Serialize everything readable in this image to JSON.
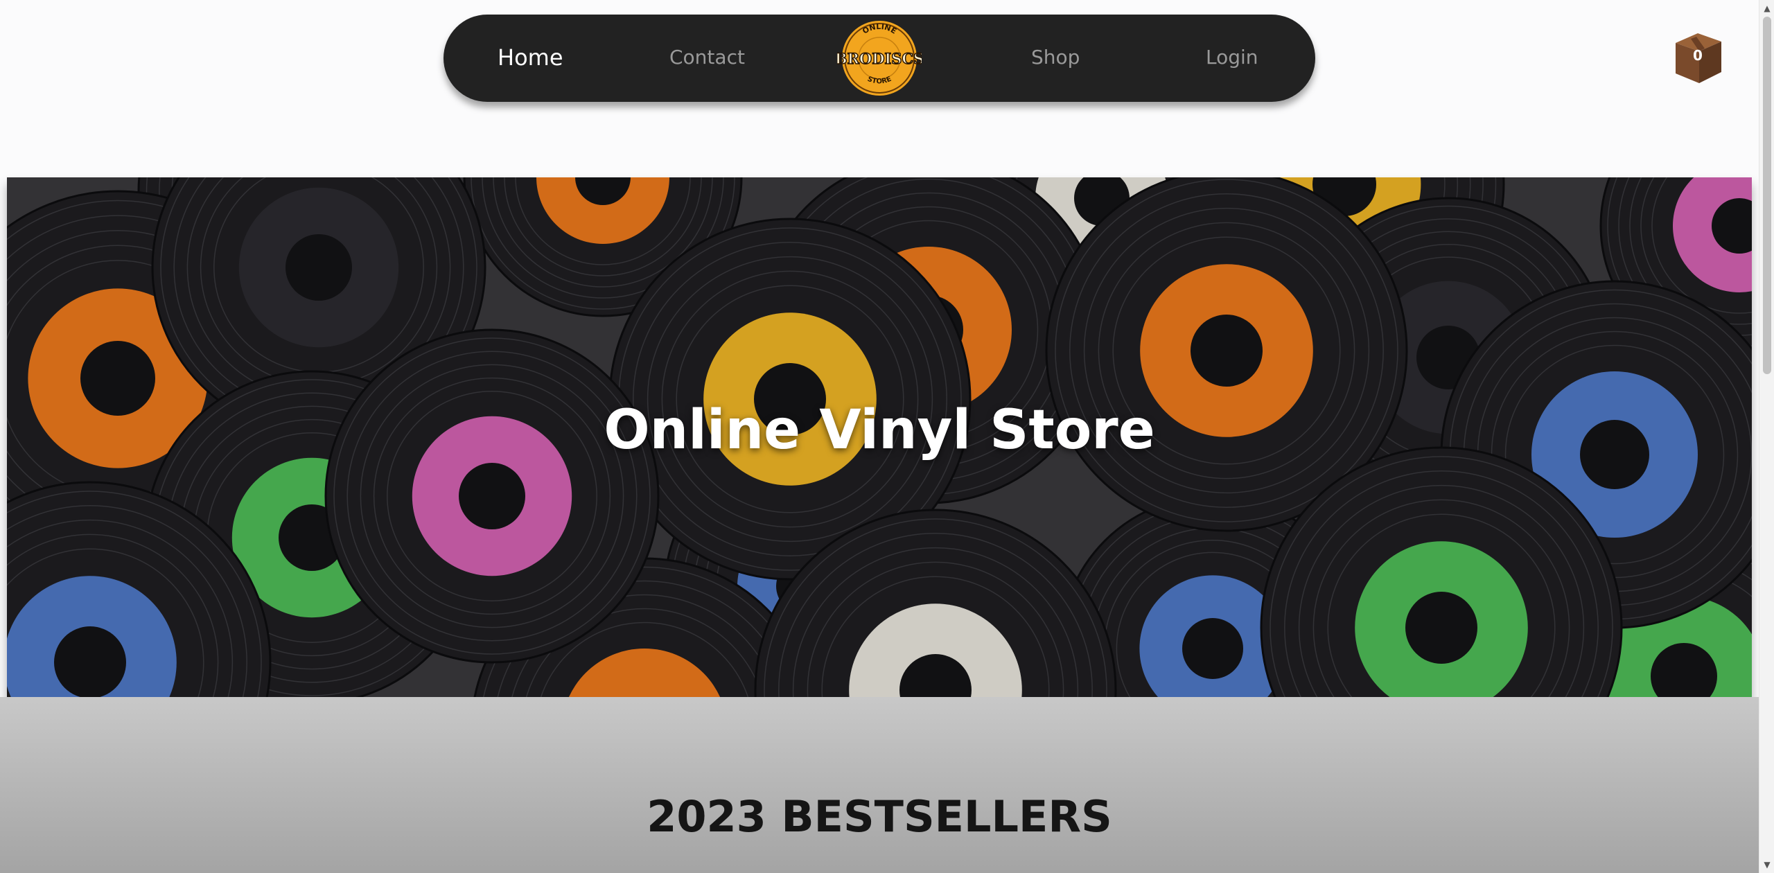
{
  "nav": {
    "home": "Home",
    "contact": "Contact",
    "shop": "Shop",
    "login": "Login"
  },
  "logo": {
    "top_text": "ONLINE",
    "name": "BRODISCS",
    "bottom_text": "STORE",
    "icon": "vinyl-record-badge-icon"
  },
  "cart": {
    "count": "0",
    "icon": "cardboard-box-icon"
  },
  "hero": {
    "title": "Online Vinyl Store"
  },
  "bestsellers": {
    "heading": "2023 BESTSELLERS"
  },
  "colors": {
    "nav_background": "#222222",
    "nav_inactive": "#9a9a9a",
    "logo_gold": "#f2a51e",
    "cart_brown": "#7a4a2b",
    "record_black": "#1f1e21",
    "label_orange": "#f07a1c",
    "label_yellow": "#f2b826",
    "label_pink": "#d664b4",
    "label_green": "#4fbf58",
    "label_blue": "#4f79c8",
    "label_cream": "#ece9e0"
  }
}
